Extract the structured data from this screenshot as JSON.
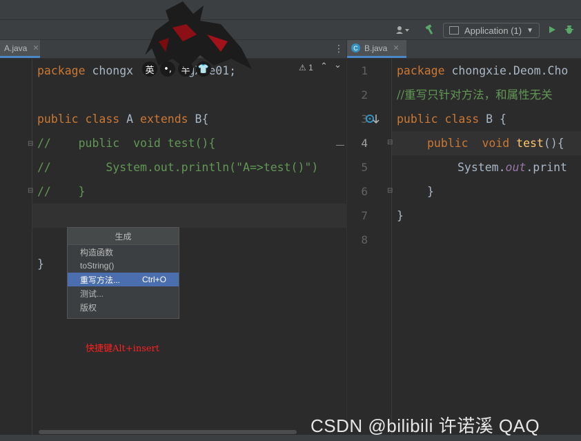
{
  "run_config": {
    "label": "Application (1)"
  },
  "tabs": {
    "left": {
      "label": "A.java",
      "close": "✕"
    },
    "right": {
      "label": "B.java",
      "close": "✕",
      "icon": "C"
    }
  },
  "inspection": {
    "warnings": "⚠ 1",
    "up": "⌃",
    "down": "⌄"
  },
  "ime": {
    "lang": "英",
    "punct": "•,",
    "half": "半",
    "shirt": "👕"
  },
  "left_code": {
    "line1_kw": "package",
    "line1_a": "chongx",
    "line1_b": "ngXie01;",
    "line2_kw1": "public",
    "line2_kw2": "class",
    "line2_name": "A",
    "line2_kw3": "extends",
    "line2_rest": "B{",
    "line3": "//    public  void test(){",
    "line4": "//        System.out.println(\"A=>test()\")",
    "line5": "//    }",
    "line6": "}"
  },
  "right_code": {
    "numbers": [
      "1",
      "2",
      "3",
      "4",
      "5",
      "6",
      "7",
      "8"
    ],
    "line1_kw": "package",
    "line1_rest": "chongxie.Deom.Cho",
    "line2": "//重写只针对方法，和属性无关",
    "line3_kw": "public class",
    "line3_rest": "B {",
    "line4_kw": "public  void",
    "line4_fn": "test",
    "line4_rest": "(){",
    "line5_a": "System.",
    "line5_field": "out",
    "line5_b": ".print",
    "line6": "}",
    "line7": "}"
  },
  "generate_menu": {
    "title": "生成",
    "items": [
      {
        "label": "构造函数",
        "shortcut": ""
      },
      {
        "label": "toString()",
        "shortcut": ""
      },
      {
        "label": "重写方法...",
        "shortcut": "Ctrl+O"
      },
      {
        "label": "测试...",
        "shortcut": ""
      },
      {
        "label": "版权",
        "shortcut": ""
      }
    ]
  },
  "annotation": "快捷键Alt+insert",
  "watermark": "CSDN @bilibili   许诺溪  QAQ",
  "colors": {
    "keyword": "#cc7832",
    "comment": "#629755",
    "selection": "#4b6eaf",
    "annotation": "#ff2020"
  }
}
